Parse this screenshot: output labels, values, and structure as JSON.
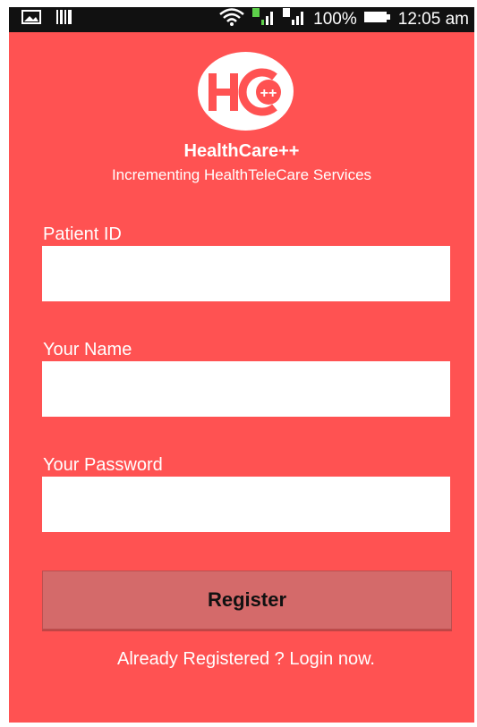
{
  "status_bar": {
    "battery": "100%",
    "time": "12:05 am",
    "icons": [
      "image-icon",
      "barcode-icon",
      "wifi-icon",
      "sim1-signal-icon",
      "sim2-signal-icon",
      "battery-icon"
    ]
  },
  "app": {
    "logo_text": "HC",
    "logo_sup": "++",
    "title": "HealthCare++",
    "subtitle": "Incrementing HealthTeleCare Services"
  },
  "form": {
    "patient_id_label": "Patient ID",
    "name_label": "Your Name",
    "password_label": "Your Password",
    "patient_id_value": "",
    "name_value": "",
    "password_value": ""
  },
  "actions": {
    "register_label": "Register",
    "login_link": "Already Registered ? Login now."
  },
  "colors": {
    "background": "#ff5252",
    "button": "#d46a6a",
    "statusbar": "#111111"
  }
}
